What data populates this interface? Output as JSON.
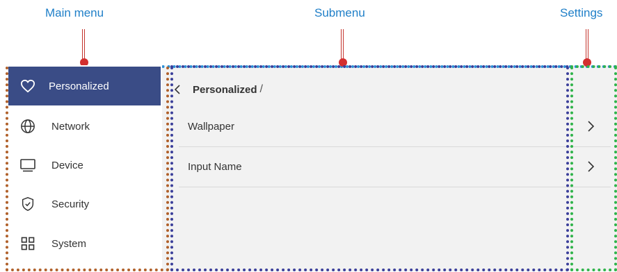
{
  "callouts": {
    "main_menu": "Main menu",
    "submenu": "Submenu",
    "settings": "Settings"
  },
  "sidebar": {
    "items": [
      {
        "label": "Personalized",
        "icon": "heart-icon",
        "active": true
      },
      {
        "label": "Network",
        "icon": "globe-icon",
        "active": false
      },
      {
        "label": "Device",
        "icon": "monitor-icon",
        "active": false
      },
      {
        "label": "Security",
        "icon": "shield-check-icon",
        "active": false
      },
      {
        "label": "System",
        "icon": "grid-icon",
        "active": false
      }
    ]
  },
  "submenu": {
    "breadcrumb": "Personalized",
    "breadcrumb_separator": "/",
    "rows": [
      {
        "label": "Wallpaper"
      },
      {
        "label": "Input Name"
      }
    ]
  },
  "colors": {
    "callout_text": "#1f7fc8",
    "leader_red": "#d32f2f",
    "active_bg": "#3a4c86",
    "main_menu_box": "#b0602a",
    "submenu_box": "#3b3f9a",
    "settings_box": "#2fb34a",
    "outer_box": "#2a8fd6"
  }
}
